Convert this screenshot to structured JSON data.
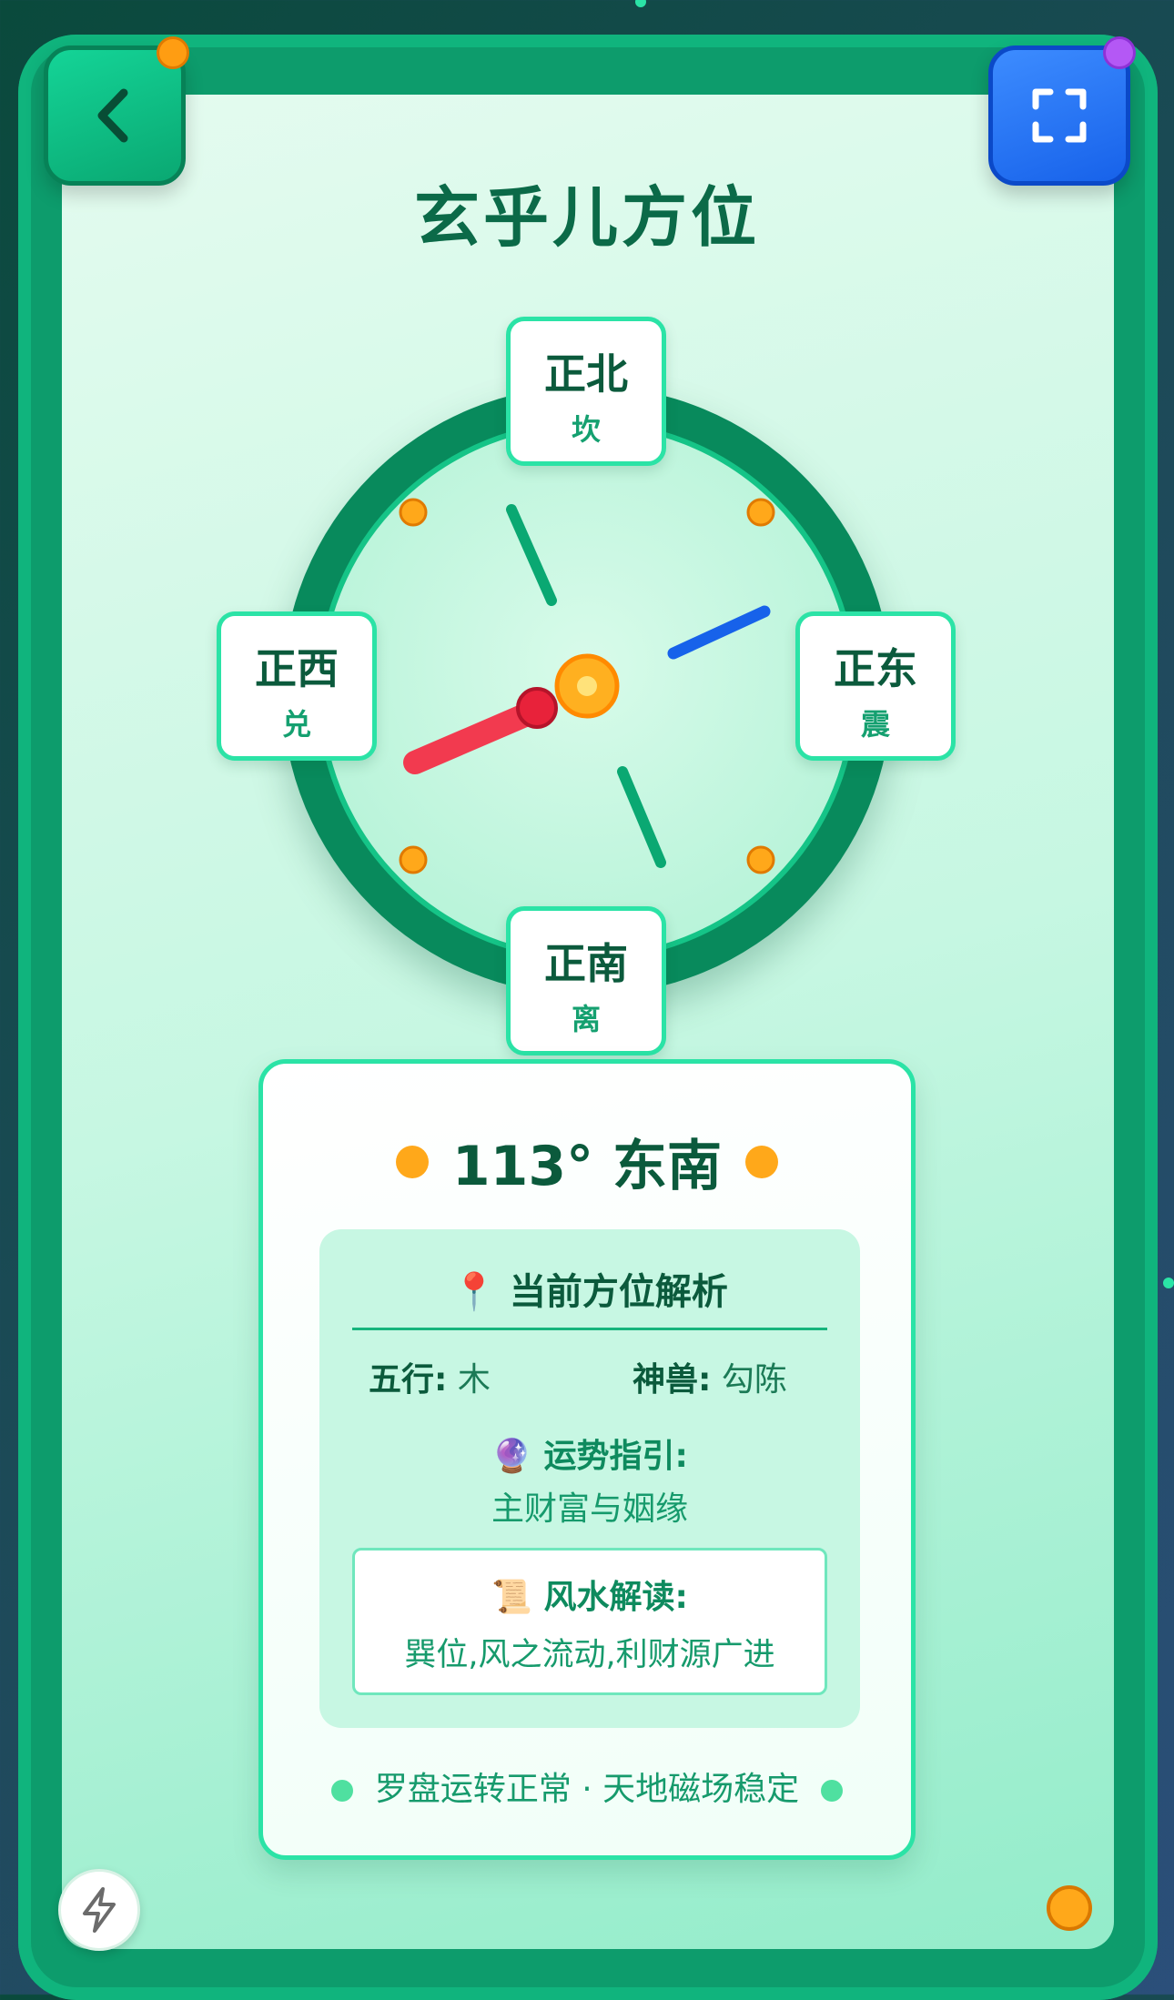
{
  "header": {
    "title": "玄乎儿方位",
    "back_icon": "chevron-left-icon",
    "fullscreen_icon": "expand-icon"
  },
  "compass": {
    "north": {
      "name": "正北",
      "trigram": "坎"
    },
    "east": {
      "name": "正东",
      "trigram": "震"
    },
    "south": {
      "name": "正南",
      "trigram": "离"
    },
    "west": {
      "name": "正西",
      "trigram": "兑"
    }
  },
  "reading": {
    "heading": "113° 东南",
    "analysis_icon": "📍",
    "analysis_title": "当前方位解析",
    "wuxing_label": "五行:",
    "wuxing_value": "木",
    "beast_label": "神兽:",
    "beast_value": "勾陈",
    "fortune_icon": "🔮",
    "fortune_title": "运势指引:",
    "fortune_text": "主财富与姻缘",
    "fengshui_icon": "📜",
    "fengshui_title": "风水解读:",
    "fengshui_text": "巽位,风之流动,利财源广进",
    "status": "罗盘运转正常 · 天地磁场稳定"
  },
  "colors": {
    "accent_green": "#0d9c6c",
    "accent_blue": "#1762ea",
    "needle_red": "#f23a4f",
    "dot_orange": "#ffa81a"
  }
}
